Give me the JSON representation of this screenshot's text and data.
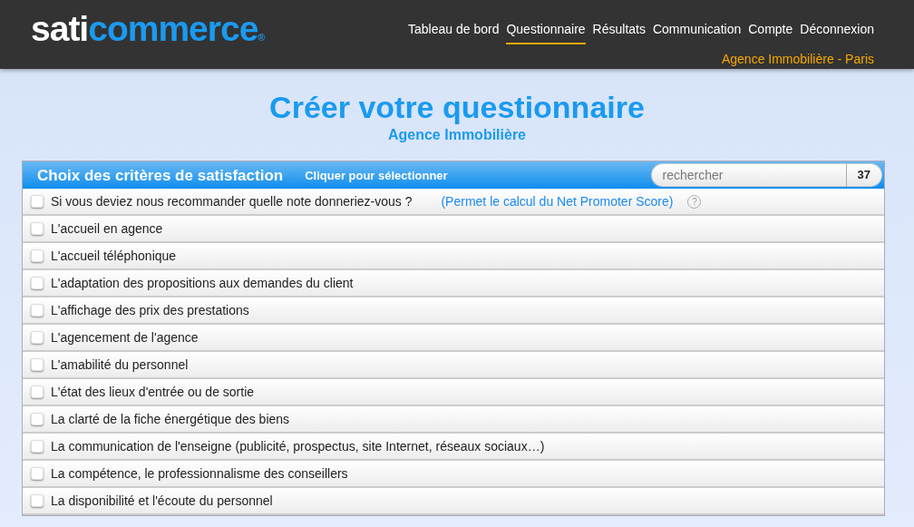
{
  "logo": {
    "part_1": "sati",
    "part_2": "commerce",
    "mark": "®"
  },
  "nav": [
    {
      "label": "Tableau de bord",
      "selected": false
    },
    {
      "label": "Questionnaire",
      "selected": true
    },
    {
      "label": "Résultats",
      "selected": false
    },
    {
      "label": "Communication",
      "selected": false
    },
    {
      "label": "Compte",
      "selected": false
    },
    {
      "label": "Déconnexion",
      "selected": false
    }
  ],
  "agency": "Agence Immobilière - Paris",
  "title": "Créer votre questionnaire",
  "subtitle": "Agence Immobilière",
  "panel": {
    "title": "Choix des critères de satisfaction",
    "hint": "Cliquer pour sélectionner",
    "search": {
      "placeholder": "rechercher"
    },
    "count": "37"
  },
  "criteria": [
    {
      "label": "Si vous deviez nous recommander quelle note donneriez-vous ?",
      "checked": false,
      "note": "(Permet le calcul du Net Promoter Score)",
      "help": "?"
    },
    {
      "label": "L'accueil en agence",
      "checked": false
    },
    {
      "label": "L'accueil téléphonique",
      "checked": false
    },
    {
      "label": "L'adaptation des propositions aux demandes du client",
      "checked": false
    },
    {
      "label": "L'affichage des prix des prestations",
      "checked": false
    },
    {
      "label": "L'agencement de l'agence",
      "checked": false
    },
    {
      "label": "L'amabilité du personnel",
      "checked": false
    },
    {
      "label": "L'état des lieux d'entrée ou de sortie",
      "checked": false
    },
    {
      "label": "La clarté de la fiche énergétique des biens",
      "checked": false
    },
    {
      "label": "La communication de l'enseigne (publicité, prospectus, site Internet, réseaux sociaux…)",
      "checked": false
    },
    {
      "label": "La compétence, le professionnalisme des conseillers",
      "checked": false
    },
    {
      "label": "La disponibilité et l'écoute du personnel",
      "checked": false
    }
  ]
}
